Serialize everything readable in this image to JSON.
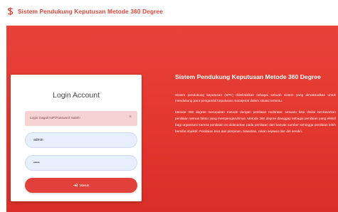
{
  "header": {
    "title": "Sistem Pendukung Keputusan Metode 360 Degree",
    "logo_icon": "dollar-sign-icon"
  },
  "login": {
    "card_title": "Login Account",
    "alert_text": "Login Gagal! NIP/Password Salah!",
    "alert_close": "×",
    "username_value": "admin",
    "password_value": "admin",
    "button_label": "Masuk",
    "button_icon": "sign-in-icon"
  },
  "info": {
    "title": "Sistem Pendukung Keputusan Metode 360 Degree",
    "paragraphs": [
      "Sistem pendukung keputusan (SPK) didefinisikan sebagai sebuah sistem yang dimaksudkan untuk mendukung para pengambil keputusan manajerial dalam situasi tertentu.",
      "Metode 360 degree merupakan metode dengan penilaian multirater, sesuatu bisa dinilai berdasarkan penilaian semua faktor yang mempengaruhinya. Metode 360 degree dianggap sebagai penilaian yang efektif bagi organisasi karena penilaian ini didasarkan pada penilaian dari banyak sumber sehingga penilaian lebih bersifat objektif. Penilaian bisa dari pimpinan, bawahan, rekan sejawat dan diri sendiri."
    ]
  },
  "colors": {
    "accent": "#e2403a",
    "alert_bg": "#f6d2d3",
    "input_bg": "#e7eefc"
  }
}
